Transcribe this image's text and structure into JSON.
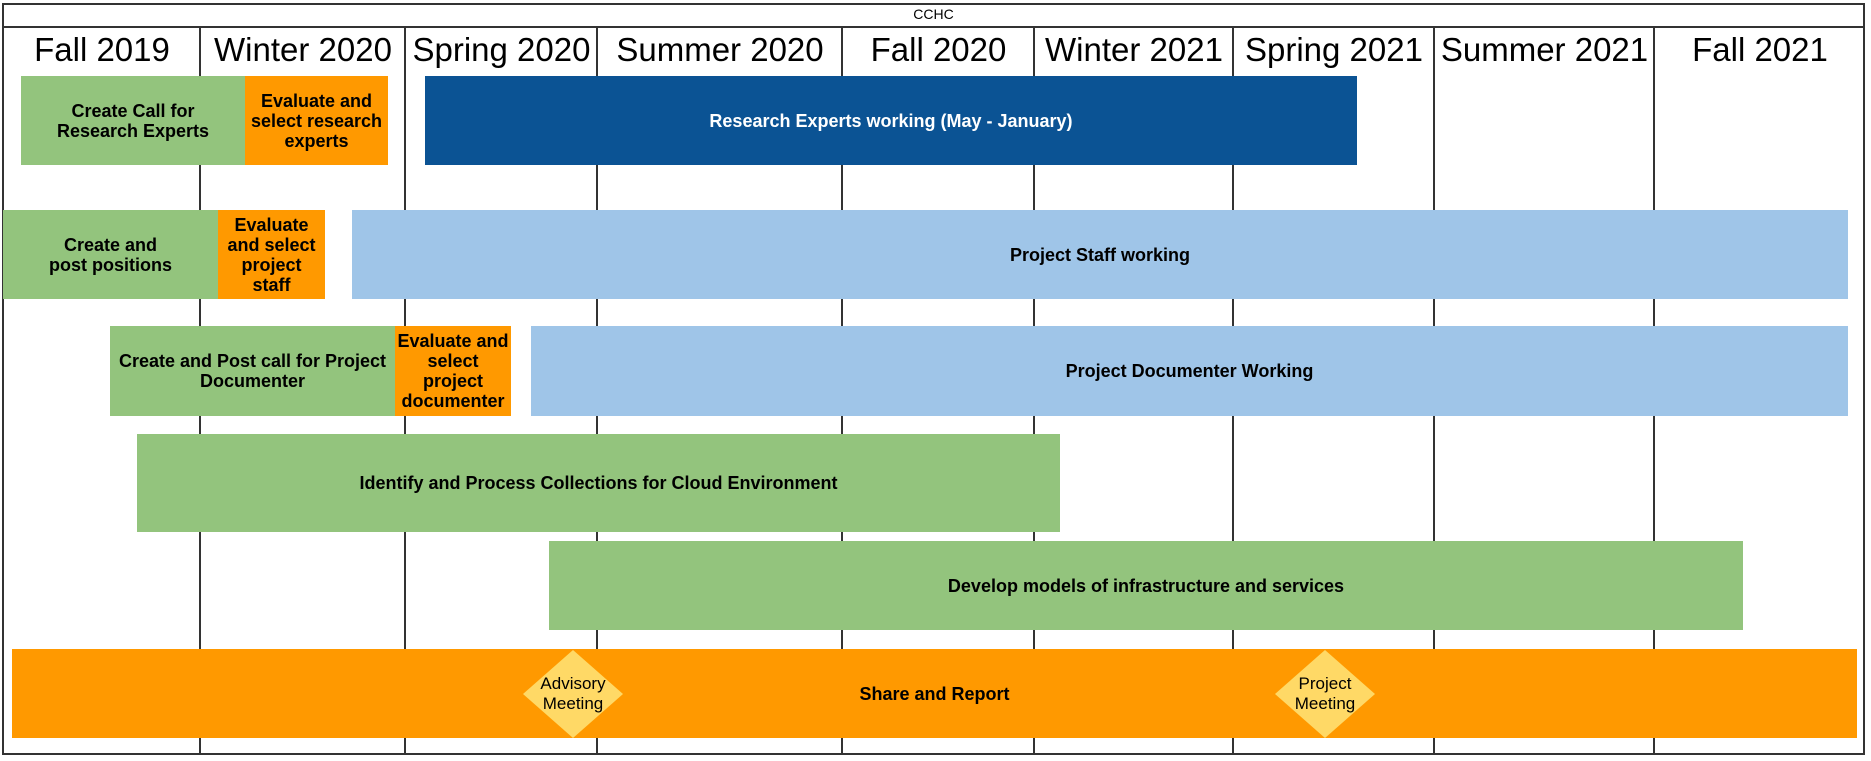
{
  "title": "CCHC",
  "colors": {
    "planning": "#93C47D",
    "evaluation": "#FF9900",
    "experts": "#0B5394",
    "working": "#9FC5E8",
    "milestone": "#FFD966",
    "gridline": "#333333"
  },
  "columns": [
    {
      "label": "Fall 2019"
    },
    {
      "label": "Winter 2020"
    },
    {
      "label": "Spring 2020"
    },
    {
      "label": "Summer 2020"
    },
    {
      "label": "Fall 2020"
    },
    {
      "label": "Winter 2021"
    },
    {
      "label": "Spring 2021"
    },
    {
      "label": "Summer 2021"
    },
    {
      "label": "Fall 2021"
    }
  ],
  "rows": [
    {
      "tasks": [
        {
          "label": "Create Call for Research Experts",
          "type": "planning"
        },
        {
          "label": "Evaluate and select research experts",
          "type": "evaluation"
        },
        {
          "label": "Research Experts working (May - January)",
          "type": "experts"
        }
      ]
    },
    {
      "tasks": [
        {
          "label": "Create and post positions",
          "type": "planning"
        },
        {
          "label": "Evaluate and select project staff",
          "type": "evaluation"
        },
        {
          "label": "Project Staff working",
          "type": "working"
        }
      ]
    },
    {
      "tasks": [
        {
          "label": "Create and Post call for Project Documenter",
          "type": "planning"
        },
        {
          "label": "Evaluate and select project documenter",
          "type": "evaluation"
        },
        {
          "label": "Project Documenter Working",
          "type": "working"
        }
      ]
    },
    {
      "tasks": [
        {
          "label": "Identify and Process Collections for Cloud Environment",
          "type": "planning"
        }
      ]
    },
    {
      "tasks": [
        {
          "label": "Develop models of infrastructure and services",
          "type": "planning"
        }
      ]
    },
    {
      "tasks": [
        {
          "label": "Share and Report",
          "type": "evaluation"
        }
      ],
      "milestones": [
        {
          "label": "Advisory Meeting"
        },
        {
          "label": "Project Meeting"
        }
      ]
    }
  ]
}
